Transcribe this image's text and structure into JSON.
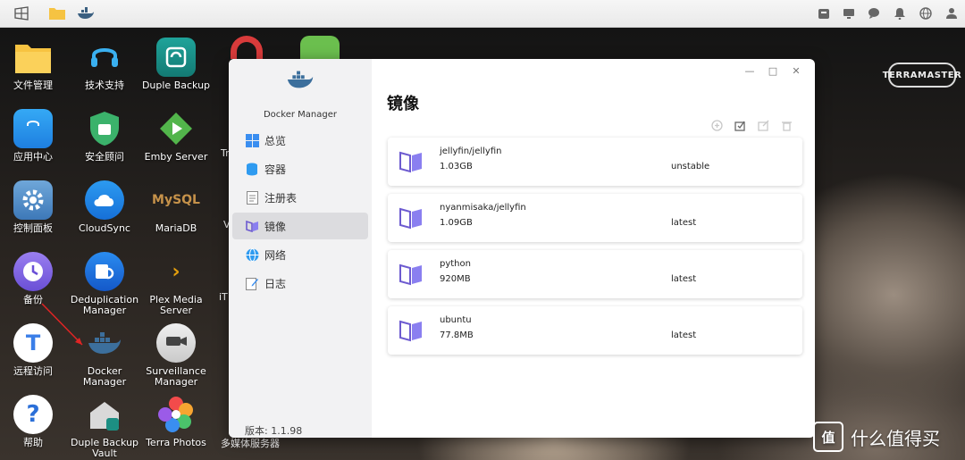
{
  "desktop": {
    "icons": [
      {
        "label": "文件管理",
        "icon": "folder-icon"
      },
      {
        "label": "技术支持",
        "icon": "headset-icon"
      },
      {
        "label": "Duple Backup",
        "icon": "duple-backup-icon"
      },
      {
        "label": "应用中心",
        "icon": "shopping-bag-icon"
      },
      {
        "label": "安全顾问",
        "icon": "shield-icon"
      },
      {
        "label": "Emby Server",
        "icon": "emby-icon"
      },
      {
        "label": "控制面板",
        "icon": "gear-icon"
      },
      {
        "label": "CloudSync",
        "icon": "cloud-sync-icon"
      },
      {
        "label": "MariaDB",
        "icon": "mysql-icon"
      },
      {
        "label": "备份",
        "icon": "clock-icon"
      },
      {
        "label": "Deduplication Manager",
        "icon": "dedup-icon"
      },
      {
        "label": "Plex Media Server",
        "icon": "plex-icon"
      },
      {
        "label": "远程访问",
        "icon": "remote-access-icon"
      },
      {
        "label": "Docker Manager",
        "icon": "docker-icon"
      },
      {
        "label": "Surveillance Manager",
        "icon": "camera-icon"
      },
      {
        "label": "帮助",
        "icon": "help-icon"
      },
      {
        "label": "Duple Backup Vault",
        "icon": "vault-icon"
      },
      {
        "label": "Terra Photos",
        "icon": "photos-icon"
      }
    ],
    "partial_labels": {
      "tr": "Tr",
      "v": "V",
      "it": "iT",
      "media": "多媒体服务器"
    },
    "logo": "TERRAMASTER"
  },
  "window": {
    "app_name": "Docker Manager",
    "title": "镜像",
    "version": "版本: 1.1.98",
    "nav": [
      {
        "label": "总览",
        "icon": "overview-icon",
        "active": false
      },
      {
        "label": "容器",
        "icon": "container-icon",
        "active": false
      },
      {
        "label": "注册表",
        "icon": "registry-icon",
        "active": false
      },
      {
        "label": "镜像",
        "icon": "image-icon",
        "active": true
      },
      {
        "label": "网络",
        "icon": "network-icon",
        "active": false
      },
      {
        "label": "日志",
        "icon": "log-icon",
        "active": false
      }
    ],
    "images": [
      {
        "name": "jellyfin/jellyfin",
        "size": "1.03GB",
        "tag": "unstable"
      },
      {
        "name": "nyanmisaka/jellyfin",
        "size": "1.09GB",
        "tag": "latest"
      },
      {
        "name": "python",
        "size": "920MB",
        "tag": "latest"
      },
      {
        "name": "ubuntu",
        "size": "77.8MB",
        "tag": "latest"
      }
    ]
  },
  "watermark": {
    "text": "什么值得买",
    "badge": "值"
  },
  "colors": {
    "accent": "#6d5bd0",
    "sidebar_bg": "#f2f2f3",
    "active_nav_bg": "#dcdcdf"
  }
}
